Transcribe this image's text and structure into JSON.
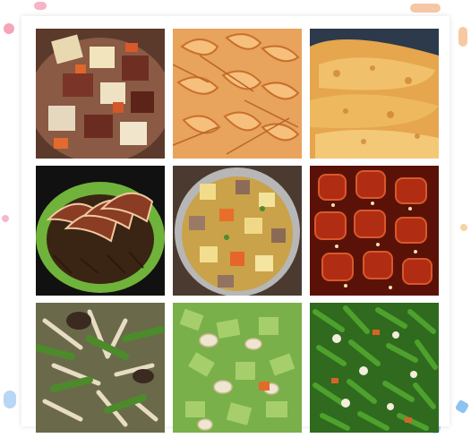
{
  "gallery": {
    "tiles": [
      {
        "icon": "beef-potato-stew-photo"
      },
      {
        "icon": "steamed-shrimp-photo"
      },
      {
        "icon": "fried-fish-fillet-photo"
      },
      {
        "icon": "braised-pork-with-preserved-greens-photo"
      },
      {
        "icon": "curry-potato-carrot-pot-photo"
      },
      {
        "icon": "sweet-sour-ribs-photo"
      },
      {
        "icon": "stir-fried-mushroom-vegetable-photo"
      },
      {
        "icon": "stir-fried-celery-mushroom-photo"
      },
      {
        "icon": "stir-fried-green-beans-photo"
      }
    ]
  }
}
